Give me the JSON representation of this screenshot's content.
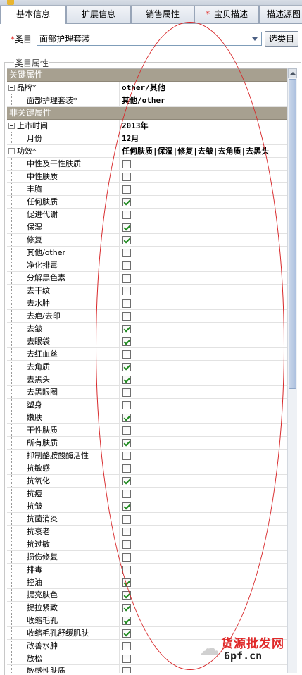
{
  "tabs": [
    {
      "label": "基本信息",
      "required": false,
      "active": true
    },
    {
      "label": "扩展信息",
      "required": false,
      "active": false
    },
    {
      "label": "销售属性",
      "required": false,
      "active": false
    },
    {
      "label": "宝贝描述",
      "required": true,
      "active": false
    },
    {
      "label": "描述源图",
      "required": false,
      "active": false
    }
  ],
  "category": {
    "required_mark": "*",
    "label": "类目",
    "value": "面部护理套装",
    "button": "选类目"
  },
  "fieldset_legend": "类目属性",
  "sections": {
    "key": "关键属性",
    "nonkey": "非关键属性"
  },
  "key_props": [
    {
      "label": "品牌*",
      "value": "other/其他",
      "expander": true
    },
    {
      "label": "面部护理套装*",
      "value": "其他/other",
      "expander": false
    }
  ],
  "nonkey_props": [
    {
      "label": "上市时间",
      "value": "2013年",
      "expander": true
    },
    {
      "label": "月份",
      "value": "12月",
      "expander": false
    }
  ],
  "effect": {
    "label": "功效*",
    "summary": "任何肤质|保湿|修复|去皱|去角质|去黑头",
    "options": [
      {
        "label": "中性及干性肤质",
        "checked": false
      },
      {
        "label": "中性肤质",
        "checked": false
      },
      {
        "label": "丰胸",
        "checked": false
      },
      {
        "label": "任何肤质",
        "checked": true
      },
      {
        "label": "促进代谢",
        "checked": false
      },
      {
        "label": "保湿",
        "checked": true
      },
      {
        "label": "修复",
        "checked": true
      },
      {
        "label": "其他/other",
        "checked": false
      },
      {
        "label": "净化排毒",
        "checked": false
      },
      {
        "label": "分解黑色素",
        "checked": false
      },
      {
        "label": "去干纹",
        "checked": false
      },
      {
        "label": "去水肿",
        "checked": false
      },
      {
        "label": "去疤/去印",
        "checked": false
      },
      {
        "label": "去皱",
        "checked": true
      },
      {
        "label": "去眼袋",
        "checked": true
      },
      {
        "label": "去红血丝",
        "checked": false
      },
      {
        "label": "去角质",
        "checked": true
      },
      {
        "label": "去黑头",
        "checked": true
      },
      {
        "label": "去黑眼圈",
        "checked": false
      },
      {
        "label": "塑身",
        "checked": false
      },
      {
        "label": "嫩肤",
        "checked": true
      },
      {
        "label": "干性肤质",
        "checked": false
      },
      {
        "label": "所有肤质",
        "checked": true
      },
      {
        "label": "抑制酪胺酸酶活性",
        "checked": false
      },
      {
        "label": "抗敏感",
        "checked": false
      },
      {
        "label": "抗氧化",
        "checked": true
      },
      {
        "label": "抗痘",
        "checked": false
      },
      {
        "label": "抗皱",
        "checked": true
      },
      {
        "label": "抗菌消炎",
        "checked": false
      },
      {
        "label": "抗衰老",
        "checked": false
      },
      {
        "label": "抗过敏",
        "checked": false
      },
      {
        "label": "损伤修复",
        "checked": false
      },
      {
        "label": "排毒",
        "checked": false
      },
      {
        "label": "控油",
        "checked": true
      },
      {
        "label": "提亮肤色",
        "checked": true
      },
      {
        "label": "提拉紧致",
        "checked": true
      },
      {
        "label": "收缩毛孔",
        "checked": true
      },
      {
        "label": "收缩毛孔舒缓肌肤",
        "checked": true
      },
      {
        "label": "改善水肿",
        "checked": false
      },
      {
        "label": "放松",
        "checked": false
      },
      {
        "label": "敏感性肤质",
        "checked": false
      }
    ]
  },
  "watermark": {
    "cn": "货源批发网",
    "url": "6pf.cn"
  },
  "colors": {
    "section_header": "#a7a090",
    "required": "#e2211c",
    "annotation_ellipse": "#d8282a"
  }
}
